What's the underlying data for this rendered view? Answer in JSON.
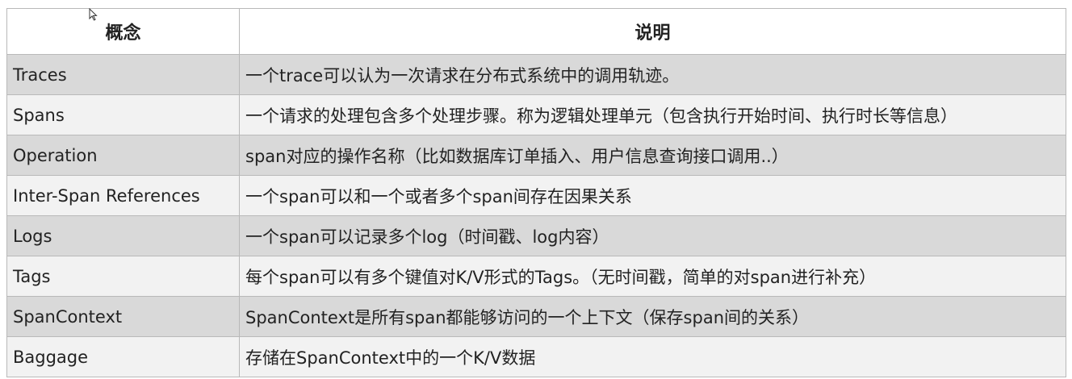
{
  "header": {
    "concept": "概念",
    "description": "说明"
  },
  "rows": [
    {
      "concept": "Traces",
      "description": "一个trace可以认为一次请求在分布式系统中的调用轨迹。"
    },
    {
      "concept": "Spans",
      "description": "一个请求的处理包含多个处理步骤。称为逻辑处理单元（包含执行开始时间、执行时长等信息）"
    },
    {
      "concept": "Operation",
      "description": "span对应的操作名称（比如数据库订单插入、用户信息查询接口调用..）"
    },
    {
      "concept": "Inter-Span References",
      "description": "一个span可以和一个或者多个span间存在因果关系"
    },
    {
      "concept": "Logs",
      "description": "一个span可以记录多个log（时间戳、log内容）"
    },
    {
      "concept": "Tags",
      "description": "每个span可以有多个键值对K/V形式的Tags。（无时间戳，简单的对span进行补充）"
    },
    {
      "concept": "SpanContext",
      "description": "SpanContext是所有span都能够访问的一个上下文（保存span间的关系）"
    },
    {
      "concept": "Baggage",
      "description": "存储在SpanContext中的一个K/V数据"
    }
  ],
  "colors": {
    "row_shaded": "#d9d9d9",
    "row_plain": "#f2f2f2",
    "border": "#b9b9b9"
  },
  "icons": {
    "cursor": "mouse-pointer-icon"
  }
}
